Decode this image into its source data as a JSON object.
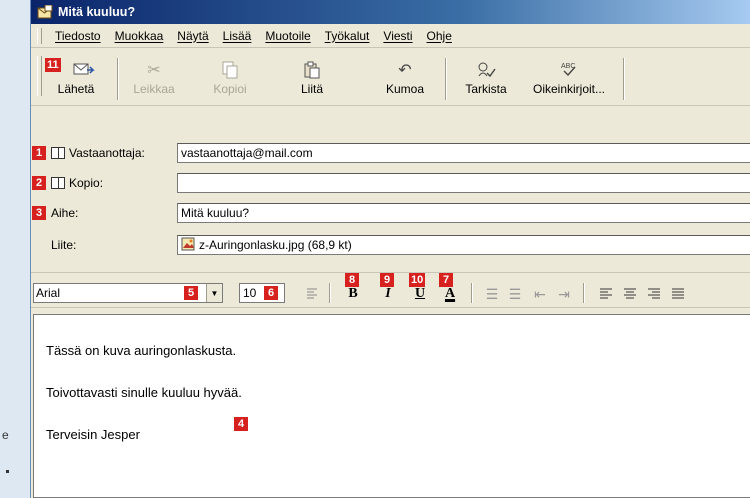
{
  "window": {
    "title": "Mitä kuuluu?"
  },
  "menu": [
    "Tiedosto",
    "Muokkaa",
    "Näytä",
    "Lisää",
    "Muotoile",
    "Työkalut",
    "Viesti",
    "Ohje"
  ],
  "toolbar": {
    "send": "Lähetä",
    "cut": "Leikkaa",
    "copy": "Kopioi",
    "paste": "Liitä",
    "undo": "Kumoa",
    "check": "Tarkista",
    "spell": "Oikeinkirjoit..."
  },
  "fields": {
    "to_label": "Vastaanottaja:",
    "to_value": "vastaanottaja@mail.com",
    "cc_label": "Kopio:",
    "cc_value": "",
    "subject_label": "Aihe:",
    "subject_value": "Mitä kuuluu?",
    "attach_label": "Liite:",
    "attach_value": "z-Auringonlasku.jpg (68,9 kt)"
  },
  "format": {
    "font": "Arial",
    "size": "10",
    "bold": "B",
    "italic": "I",
    "underline": "U",
    "color": "A"
  },
  "body": {
    "line1": "Tässä on kuva auringonlaskusta.",
    "line2": "Toivottavasti sinulle kuuluu hyvää.",
    "line3": "Terveisin Jesper"
  },
  "badges": {
    "b1": "1",
    "b2": "2",
    "b3": "3",
    "b4": "4",
    "b5": "5",
    "b6": "6",
    "b7": "7",
    "b8": "8",
    "b9": "9",
    "b10": "10",
    "b11": "11"
  },
  "margin_text": "e",
  "colors": {
    "badge": "#d7211e",
    "titlebar": "#0a246a",
    "background": "#dde8f2"
  }
}
